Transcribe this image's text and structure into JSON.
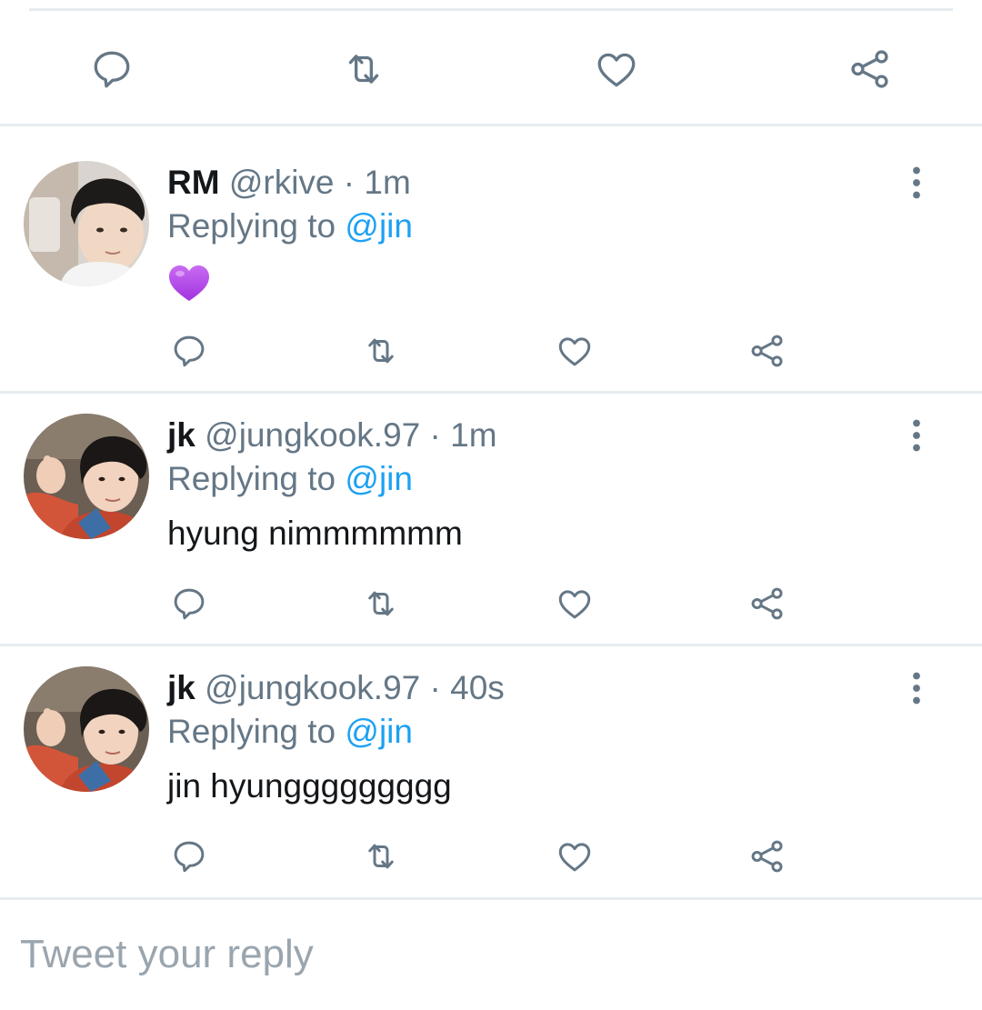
{
  "colors": {
    "text": "#14171a",
    "secondary": "#657786",
    "accent": "#1da1f2",
    "icon": "#657786",
    "divider": "#e6ecf0",
    "heart_emoji": "#b44ee8"
  },
  "main_actions": {
    "icons": [
      "reply-icon",
      "retweet-icon",
      "like-icon",
      "share-icon"
    ]
  },
  "replies": [
    {
      "name": "RM",
      "handle": "@rkive",
      "dot": "·",
      "time": "1m",
      "replying_prefix": "Replying to ",
      "replying_to": "@jin",
      "text": "",
      "emoji": "purple-heart-emoji"
    },
    {
      "name": "jk",
      "handle": "@jungkook.97",
      "dot": "·",
      "time": "1m",
      "replying_prefix": "Replying to ",
      "replying_to": "@jin",
      "text": "hyung nimmmmmm"
    },
    {
      "name": "jk",
      "handle": "@jungkook.97",
      "dot": "·",
      "time": "40s",
      "replying_prefix": "Replying to ",
      "replying_to": "@jin",
      "text": "jin hyunggggggggg"
    }
  ],
  "compose": {
    "placeholder": "Tweet your reply"
  }
}
